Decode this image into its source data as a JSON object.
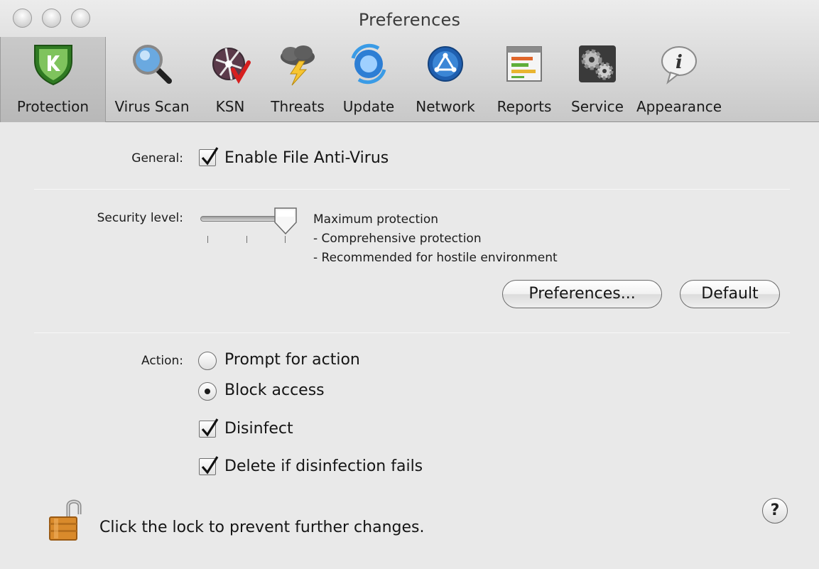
{
  "window": {
    "title": "Preferences"
  },
  "toolbar": {
    "items": [
      {
        "label": "Protection",
        "icon": "shield-k-icon",
        "selected": true
      },
      {
        "label": "Virus Scan",
        "icon": "magnifier-icon",
        "selected": false
      },
      {
        "label": "KSN",
        "icon": "ksn-globe-icon",
        "selected": false
      },
      {
        "label": "Threats",
        "icon": "storm-cloud-icon",
        "selected": false
      },
      {
        "label": "Update",
        "icon": "update-globe-icon",
        "selected": false
      },
      {
        "label": "Network",
        "icon": "network-globe-icon",
        "selected": false
      },
      {
        "label": "Reports",
        "icon": "reports-icon",
        "selected": false
      },
      {
        "label": "Service",
        "icon": "gears-icon",
        "selected": false
      },
      {
        "label": "Appearance",
        "icon": "info-bubble-icon",
        "selected": false
      }
    ]
  },
  "general": {
    "label": "General:",
    "enable_antivirus": {
      "label": "Enable File Anti-Virus",
      "checked": true
    }
  },
  "security": {
    "label": "Security level:",
    "level_index": 3,
    "level_count": 3,
    "description": [
      "Maximum protection",
      "- Comprehensive protection",
      "- Recommended for hostile environment"
    ],
    "preferences_button": "Preferences...",
    "default_button": "Default"
  },
  "action": {
    "label": "Action:",
    "prompt": {
      "label": "Prompt for action",
      "selected": false
    },
    "block": {
      "label": "Block access",
      "selected": true
    },
    "disinfect": {
      "label": "Disinfect",
      "checked": true
    },
    "delete": {
      "label": "Delete if disinfection fails",
      "checked": true
    }
  },
  "footer": {
    "lock_text": "Click the lock to prevent further changes.",
    "lock_icon": "unlocked-padlock-icon",
    "help_label": "?"
  },
  "colors": {
    "shield_green": "#3f8f2e",
    "lock_orange": "#d98a2b"
  }
}
